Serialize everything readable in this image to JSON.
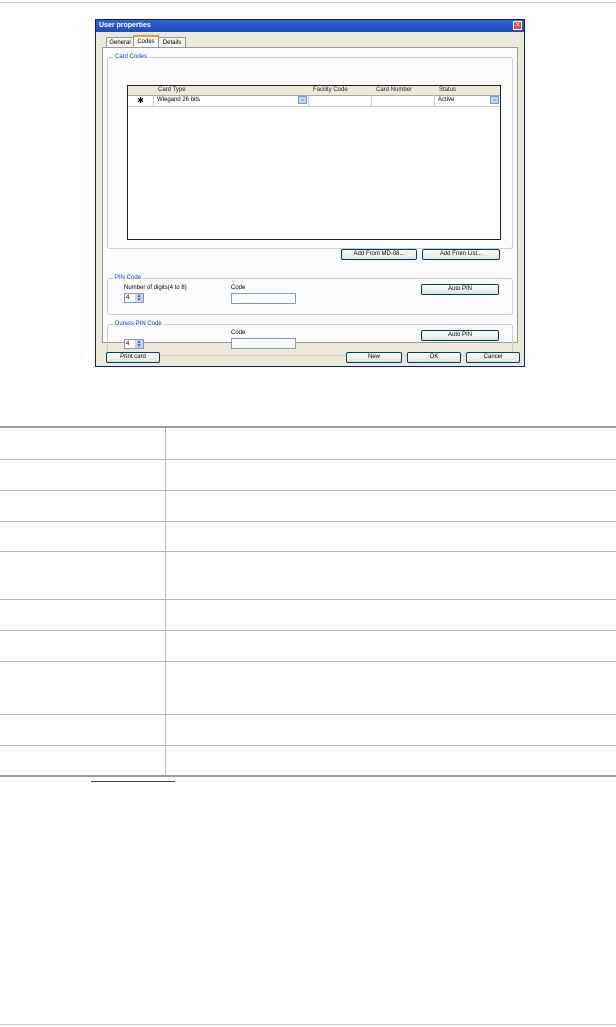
{
  "dialog": {
    "title": "User properties",
    "close_glyph": "✕",
    "tabs": [
      {
        "label": "General"
      },
      {
        "label": "Codes"
      },
      {
        "label": "Details"
      }
    ],
    "card_codes": {
      "group_label": "Card Codes",
      "columns": [
        "Card Type",
        "Facility Code",
        "Card Number",
        "Status"
      ],
      "row": {
        "marker": "✱",
        "card_type": "Wiegand 26 bits",
        "facility_code": "",
        "card_number": "",
        "status": "Active"
      },
      "add_from_md_label": "Add From MD-08...",
      "add_from_list_label": "Add From List..."
    },
    "pin_code": {
      "group_label": "PIN Code",
      "digits_label": "Number of digits(4 to 8)",
      "digits_value": "4",
      "code_label": "Code",
      "auto_pin_label": "Auto PIN"
    },
    "duress_pin_code": {
      "group_label": "Duress PIN Code",
      "digits_value": "4",
      "code_label": "Code",
      "auto_pin_label": "Auto PIN"
    },
    "footer": {
      "print_card_label": "Print card",
      "new_label": "New",
      "ok_label": "OK",
      "cancel_label": "Cancel"
    }
  }
}
